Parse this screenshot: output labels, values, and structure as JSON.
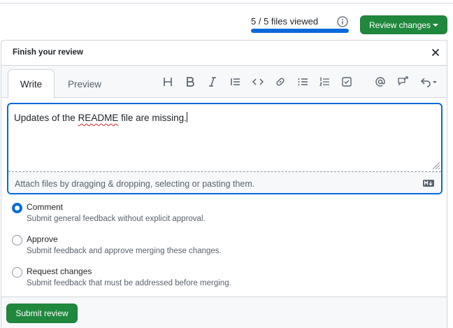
{
  "header": {
    "files_viewed_text": "5 / 5 files viewed",
    "files_viewed_progress": 1.0,
    "review_button_label": "Review changes"
  },
  "panel": {
    "title": "Finish your review",
    "tabs": [
      {
        "label": "Write",
        "active": true
      },
      {
        "label": "Preview",
        "active": false
      }
    ],
    "toolbar_icons": [
      "heading-icon",
      "bold-icon",
      "italic-icon",
      "quote-icon",
      "code-icon",
      "link-icon",
      "unordered-list-icon",
      "ordered-list-icon",
      "task-list-icon",
      "mention-icon",
      "reference-icon",
      "undo-icon"
    ],
    "editor": {
      "text_before": "Updates of the ",
      "misspelled": "README",
      "text_after": " file are missing.",
      "attach_hint": "Attach files by dragging & dropping, selecting or pasting them."
    },
    "options": [
      {
        "label": "Comment",
        "description": "Submit general feedback without explicit approval.",
        "checked": true
      },
      {
        "label": "Approve",
        "description": "Submit feedback and approve merging these changes.",
        "checked": false
      },
      {
        "label": "Request changes",
        "description": "Submit feedback that must be addressed before merging.",
        "checked": false
      }
    ],
    "submit_label": "Submit review"
  },
  "colors": {
    "primary_green": "#1f883d",
    "accent_blue": "#0969da",
    "border": "#d0d7de",
    "muted_text": "#59636e"
  }
}
